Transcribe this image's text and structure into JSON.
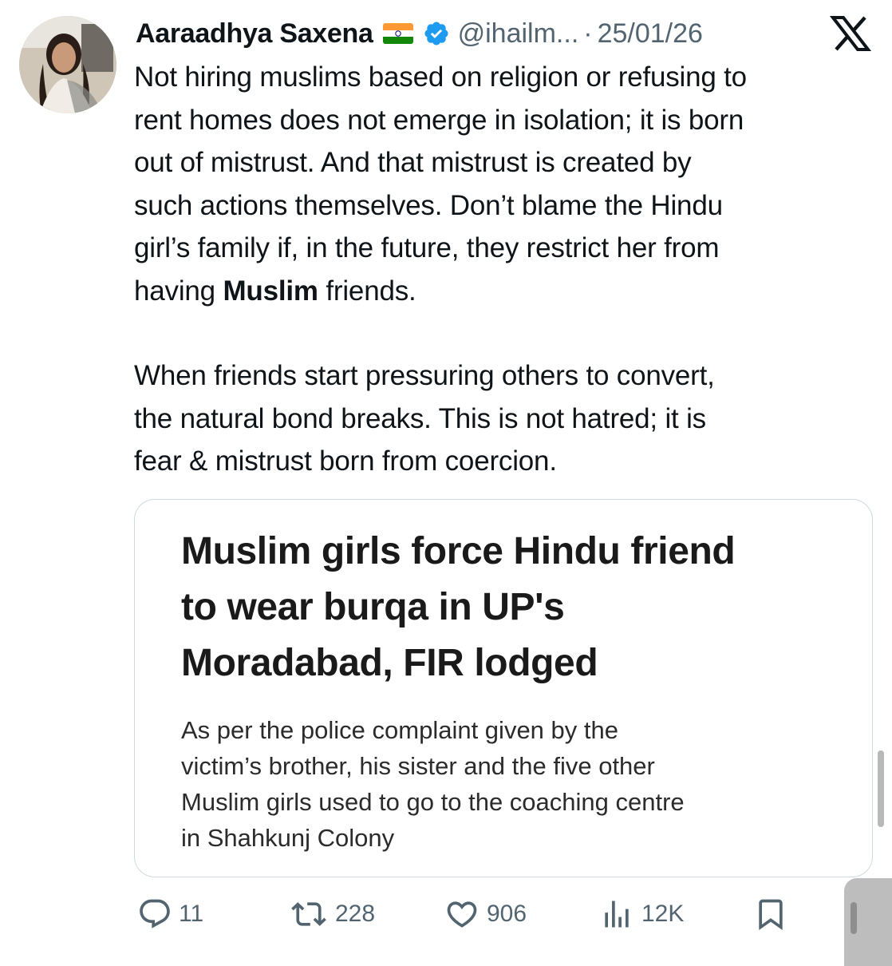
{
  "author": {
    "display_name": "Aaraadhya Saxena",
    "flag_emoji": "🇮🇳",
    "handle": "@ihailm...",
    "separator": "·",
    "date": "25/01/26"
  },
  "post": {
    "lines_p1": [
      "Not hiring muslims based on religion or refusing to",
      "rent homes does not emerge in isolation; it is born",
      "out of mistrust. And that mistrust is created by",
      "such actions themselves. Don’t blame the Hindu",
      "girl’s family if, in the future, they restrict her from"
    ],
    "last_line_prefix": "having ",
    "last_line_bold": "Muslim",
    "last_line_suffix": " friends.",
    "lines_p2": [
      "When friends start pressuring others to convert,",
      "the natural bond breaks. This is not hatred; it is",
      "fear & mistrust born from coercion."
    ]
  },
  "card": {
    "headline_lines": [
      "Muslim girls force Hindu friend",
      "to wear burqa in UP's",
      "Moradabad, FIR lodged"
    ],
    "description_lines": [
      "As per the police complaint given by the",
      "victim’s brother, his sister and the five other",
      "Muslim girls used to go to the coaching centre",
      "in Shahkunj Colony"
    ]
  },
  "actions": {
    "replies": "11",
    "reposts": "228",
    "likes": "906",
    "views": "12K"
  },
  "icons": {
    "logo": "x-logo-icon",
    "verified": "verified-badge-icon",
    "reply": "reply-icon",
    "repost": "repost-icon",
    "like": "heart-icon",
    "views": "views-chart-icon",
    "bookmark": "bookmark-icon"
  },
  "colors": {
    "text": "#0f1419",
    "secondary": "#536471",
    "verified_blue": "#1d9bf0",
    "card_border": "#cfd9de"
  }
}
